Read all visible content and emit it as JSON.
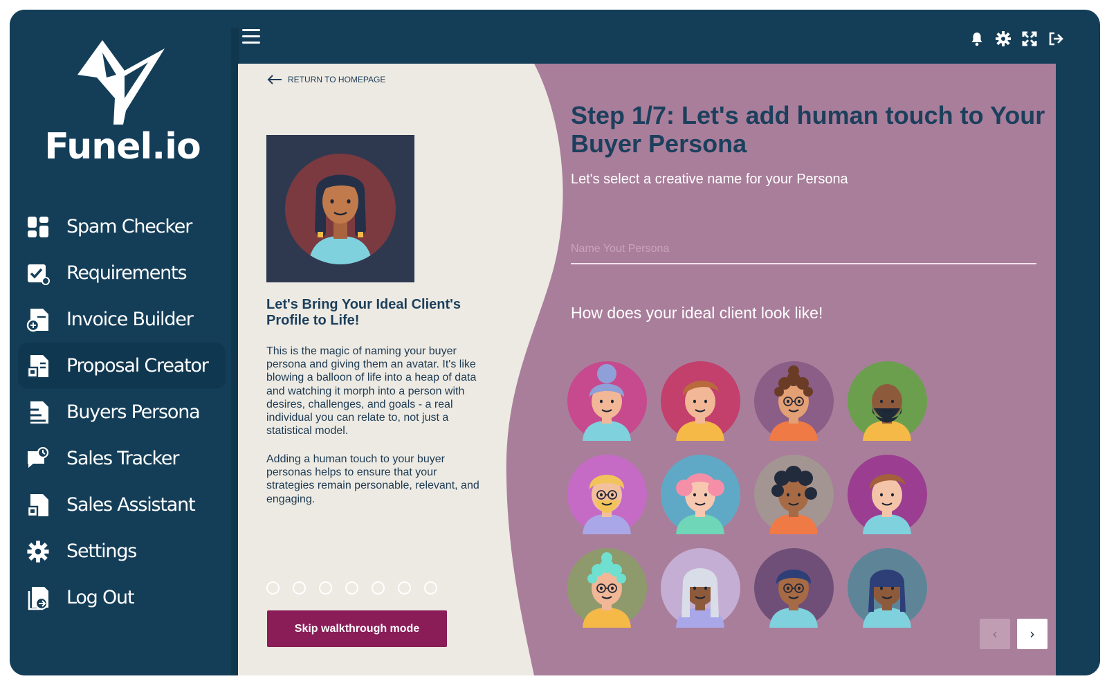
{
  "brand": {
    "name": "Funel.io"
  },
  "colors": {
    "sidebar": "#143e58",
    "accent": "#8a1d58",
    "panel_left": "#edeae3",
    "panel_right": "#a97e9a",
    "heading": "#1b3f5c"
  },
  "sidebar": {
    "items": [
      {
        "label": "Spam Checker",
        "icon": "dashboard-icon"
      },
      {
        "label": "Requirements",
        "icon": "checklist-icon"
      },
      {
        "label": "Invoice Builder",
        "icon": "invoice-icon"
      },
      {
        "label": "Proposal Creator",
        "icon": "proposal-icon",
        "active": true
      },
      {
        "label": "Buyers Persona",
        "icon": "persona-icon"
      },
      {
        "label": "Sales Tracker",
        "icon": "chat-icon"
      },
      {
        "label": "Sales Assistant",
        "icon": "document-icon"
      },
      {
        "label": "Settings",
        "icon": "gear-icon"
      },
      {
        "label": "Log Out",
        "icon": "logout-icon"
      }
    ]
  },
  "topbar": {
    "icons": [
      "menu-icon",
      "bell-icon",
      "gear-icon",
      "fullscreen-icon",
      "sign-out-icon"
    ]
  },
  "left": {
    "return_label": "RETURN TO HOMEPAGE",
    "heading": "Let's Bring Your Ideal Client's Profile to Life!",
    "para1": "This is the magic of naming your buyer persona and giving them an avatar. It's like blowing a balloon of life into a heap of data and watching it morph into a person with desires, challenges, and goals - a real individual you can relate to, not just a statistical model.",
    "para2": "Adding a human touch to your buyer personas helps to ensure that your strategies remain personable, relevant, and engaging.",
    "step_count": 7,
    "skip_label": "Skip walkthrough mode"
  },
  "right": {
    "title": "Step 1/7: Let's add human touch to Your Buyer Persona",
    "subtitle": "Let's select a creative name for your Persona",
    "name_placeholder": "Name Yout Persona",
    "name_value": "",
    "look_title": "How does your ideal client look like!",
    "avatars": [
      {
        "bg": "#c64a8d",
        "skin": "#f2b796",
        "hair": "#8fa0d8",
        "shirt": "#7fd1de",
        "style": "bun"
      },
      {
        "bg": "#c33f6c",
        "skin": "#f2b796",
        "hair": "#b96a3d",
        "shirt": "#f5b947",
        "style": "short"
      },
      {
        "bg": "#8a5e86",
        "skin": "#e3a074",
        "hair": "#6a3c26",
        "shirt": "#ef7a45",
        "style": "curly"
      },
      {
        "bg": "#6b9f4e",
        "skin": "#8e5a3c",
        "hair": "#1f2a38",
        "shirt": "#f5b947",
        "style": "beard"
      },
      {
        "bg": "#c56bc6",
        "skin": "#f2c09c",
        "hair": "#f2c35a",
        "shirt": "#a9a7e8",
        "style": "beard-light"
      },
      {
        "bg": "#5fa9c6",
        "skin": "#f7c7b0",
        "hair": "#f58fa8",
        "shirt": "#6fd6b8",
        "style": "puffs"
      },
      {
        "bg": "#a39592",
        "skin": "#a66a45",
        "hair": "#222b3c",
        "shirt": "#ef7a45",
        "style": "curly-dark"
      },
      {
        "bg": "#9b3d91",
        "skin": "#f4c4a8",
        "hair": "#a4603a",
        "shirt": "#7fd1de",
        "style": "short"
      },
      {
        "bg": "#8e9a6c",
        "skin": "#f2b796",
        "hair": "#6fe0d0",
        "shirt": "#f5b947",
        "style": "curly"
      },
      {
        "bg": "#c5aed3",
        "skin": "#8e5a3c",
        "hair": "#d9dde8",
        "shirt": "#a9a7e8",
        "style": "long"
      },
      {
        "bg": "#6f4f78",
        "skin": "#a66a45",
        "hair": "#2e3f78",
        "shirt": "#7fd1de",
        "style": "glasses"
      },
      {
        "bg": "#5d8597",
        "skin": "#8e5a3c",
        "hair": "#2e3f78",
        "shirt": "#7fd1de",
        "style": "braids"
      }
    ]
  }
}
